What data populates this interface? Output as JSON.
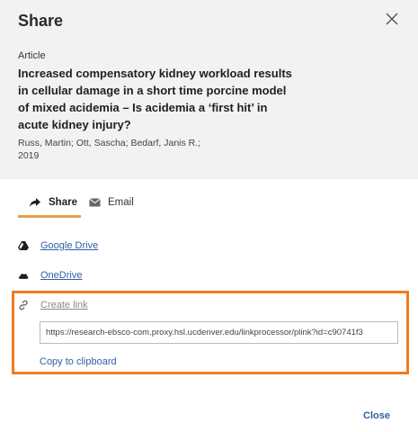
{
  "dialog": {
    "title": "Share",
    "close_icon": "close-icon"
  },
  "article": {
    "type": "Article",
    "title": "Increased compensatory kidney workload results in cellular damage in a short time porcine model of mixed acidemia – Is acidemia a ‘first hit’ in acute kidney injury?",
    "authors": "Russ, Martin; Ott, Sascha; Bedarf, Janis R.;",
    "year": "2019"
  },
  "tabs": [
    {
      "label": "Share",
      "icon": "share-arrow-icon",
      "active": true
    },
    {
      "label": "Email",
      "icon": "envelope-icon",
      "active": false
    }
  ],
  "options": {
    "google_drive": {
      "label": "Google Drive",
      "icon": "google-drive-icon"
    },
    "onedrive": {
      "label": "OneDrive",
      "icon": "cloud-icon"
    },
    "create_link": {
      "label": "Create link",
      "icon": "link-icon"
    }
  },
  "link": {
    "url": "https://research-ebsco-com.proxy.hsl.ucdenver.edu/linkprocessor/plink?id=c90741f3",
    "copy_label": "Copy to clipboard"
  },
  "footer": {
    "close_label": "Close"
  },
  "colors": {
    "header_bg": "#f2f2f2",
    "link": "#2f5f9f",
    "tab_indicator": "#e8a04a",
    "highlight_border": "#f07b1f"
  }
}
